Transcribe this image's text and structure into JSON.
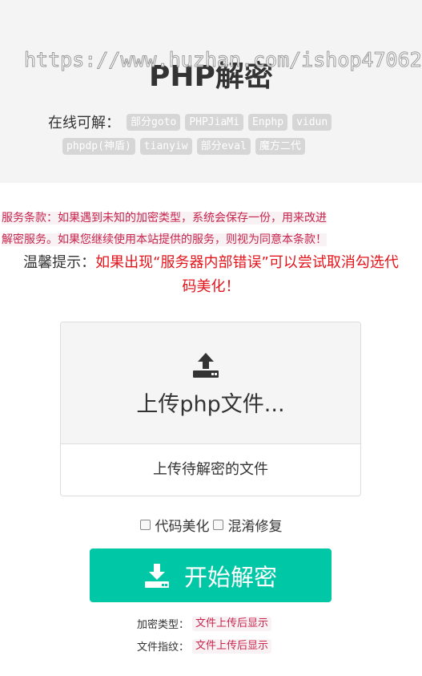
{
  "header": {
    "title": "PHP解密",
    "watermark": "https://www.huzhan.com/ishop47062"
  },
  "online": {
    "label": "在线可解：",
    "tags_row1": [
      "部分goto",
      "PHPJiaMi",
      "Enphp",
      "vidun"
    ],
    "tags_row2": [
      "phpdp(神盾)",
      "tianyiw",
      "部分eval",
      "魔方二代"
    ]
  },
  "notice": {
    "terms_line1": "服务条款：如果遇到未知的加密类型，系统会保存一份，用来改进",
    "terms_line2": "解密服务。如果您继续使用本站提供的服务，则视为同意本条款！",
    "tip_prefix": "温馨提示：",
    "tip_red_1": "如果出现“服务器内部错误”可以尝试取消勾选代",
    "tip_red_2": "码美化！"
  },
  "upload": {
    "button_label": "上传php文件...",
    "hint": "上传待解密的文件"
  },
  "options": {
    "beautify_label": "代码美化",
    "beautify_checked": false,
    "obfuscation_label": "混淆修复",
    "obfuscation_checked": false
  },
  "action": {
    "start_label": "开始解密"
  },
  "result": {
    "type_label": "加密类型：",
    "type_value": "文件上传后显示",
    "fingerprint_label": "文件指纹：",
    "fingerprint_value": "文件上传后显示"
  },
  "colors": {
    "accent": "#00c8a7",
    "warning_red": "#e4141b",
    "code_red": "#c7254e",
    "tag_gray": "#d6d6d6"
  },
  "icons": {
    "upload": "upload-icon",
    "download": "download-icon"
  }
}
